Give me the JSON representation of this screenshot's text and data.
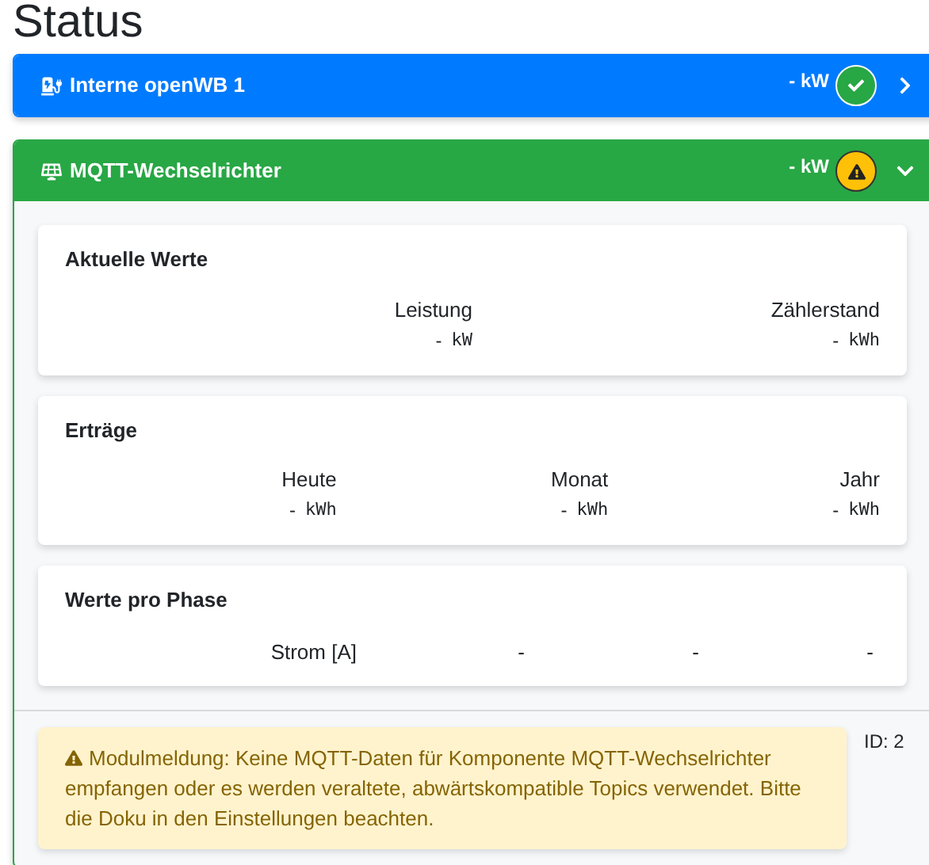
{
  "page_title": "Status",
  "components": [
    {
      "kind": "charger",
      "title": "Interne openWB 1",
      "power": "- kW",
      "warning": false,
      "expanded": false
    },
    {
      "kind": "inverter",
      "title": "MQTT-Wechselrichter",
      "power": "- kW",
      "warning": true,
      "expanded": true,
      "sections": [
        {
          "title": "Aktuelle Werte",
          "columns": [
            {
              "label": "Leistung",
              "value": "-",
              "unit": "kW"
            },
            {
              "label": "Zählerstand",
              "value": "-",
              "unit": "kWh"
            }
          ]
        },
        {
          "title": "Erträge",
          "columns": [
            {
              "label": "Heute",
              "value": "-",
              "unit": "kWh"
            },
            {
              "label": "Monat",
              "value": "-",
              "unit": "kWh"
            },
            {
              "label": "Jahr",
              "value": "-",
              "unit": "kWh"
            }
          ]
        },
        {
          "title": "Werte pro Phase",
          "rows": [
            {
              "label": "Strom [A]",
              "values": [
                "-",
                "-",
                "-"
              ]
            }
          ]
        }
      ],
      "message": {
        "kind": "warning",
        "text": "Modulmeldung: Keine MQTT-Daten für Komponente MQTT-Wechselrichter empfangen oder es werden veraltete, abwärtskompatible Topics verwendet. Bitte die Doku in den Einstellungen beachten."
      },
      "id_label": "ID: 2"
    }
  ]
}
